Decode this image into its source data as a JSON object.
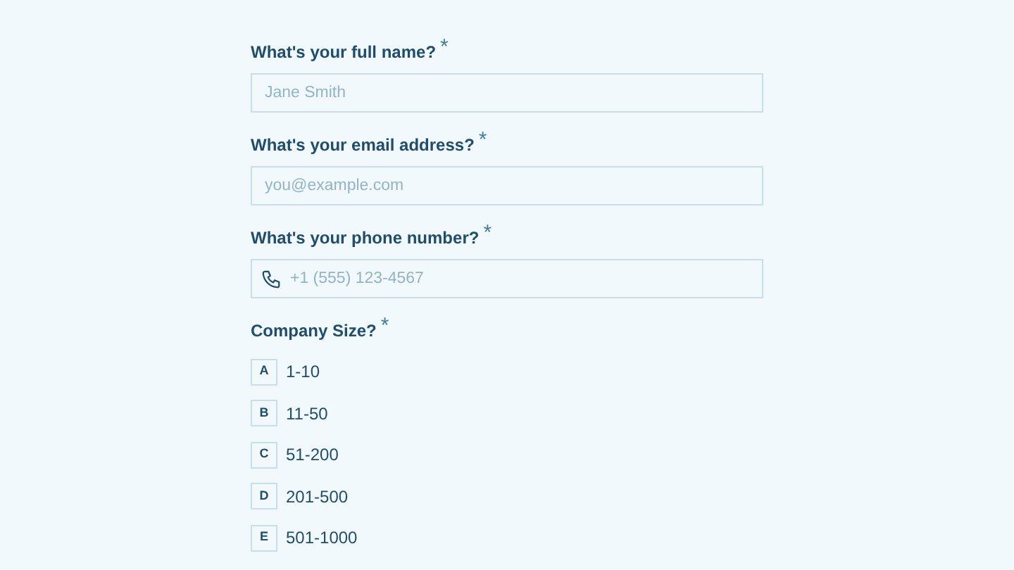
{
  "questions": [
    {
      "kind": "text",
      "label": "What's your full name?",
      "required_mark": "*",
      "placeholder": "Jane Smith"
    },
    {
      "kind": "email",
      "label": "What's your email address?",
      "required_mark": "*",
      "placeholder": "you@example.com"
    },
    {
      "kind": "phone",
      "label": "What's your phone number?",
      "required_mark": "*",
      "placeholder": "+1 (555) 123-4567"
    },
    {
      "kind": "choice",
      "label": "Company Size?",
      "required_mark": "*",
      "options": [
        {
          "key": "A",
          "label": "1-10",
          "selected": false
        },
        {
          "key": "B",
          "label": "11-50",
          "selected": false
        },
        {
          "key": "C",
          "label": "51-200",
          "selected": false
        },
        {
          "key": "D",
          "label": "201-500",
          "selected": false
        },
        {
          "key": "E",
          "label": "501-1000",
          "selected": false
        }
      ]
    }
  ]
}
